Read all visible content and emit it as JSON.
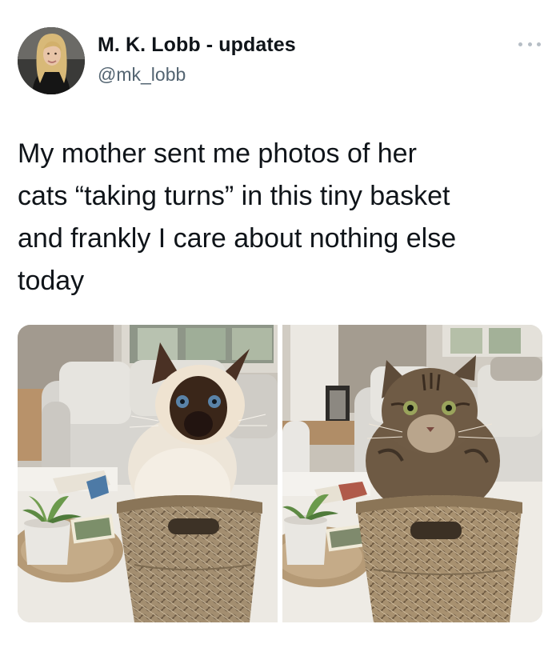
{
  "author": {
    "display_name": "M. K. Lobb - updates",
    "handle": "@mk_lobb",
    "avatar_icon": "profile-photo-woman-blonde"
  },
  "more_icon": "more-horizontal-icon",
  "tweet": {
    "text": "My mother sent me photos of her\ncats “taking turns” in this tiny basket\nand frankly I care about nothing else\ntoday"
  },
  "media": [
    {
      "subject": "siamese-cat-in-basket-photo"
    },
    {
      "subject": "tabby-cat-in-basket-photo"
    }
  ],
  "colors": {
    "text": "#0f1419",
    "secondary": "#536471",
    "dots": "#b6bec5"
  }
}
